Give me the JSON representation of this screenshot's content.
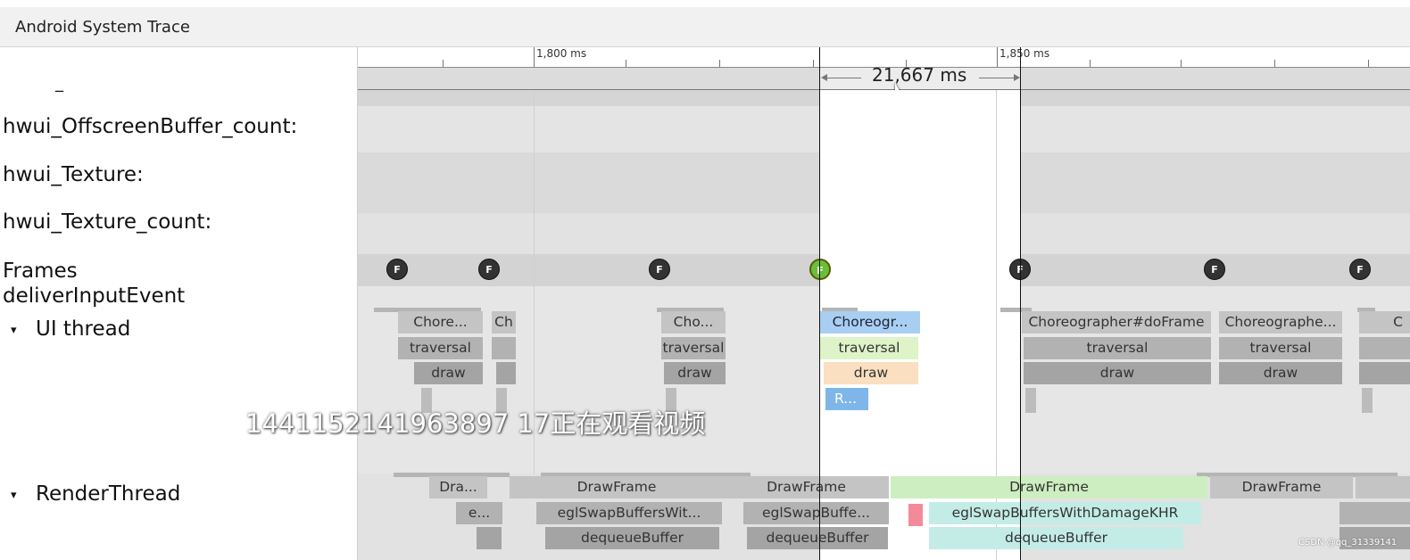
{
  "app": {
    "title": "Android System Trace"
  },
  "ruler": {
    "tick_1": "1,800 ms",
    "tick_2": "1,850 ms",
    "selection_label": "21,667 ms"
  },
  "tracks": {
    "dash": "_",
    "offscreen_buffer_count": "hwui_OffscreenBuffer_count:",
    "texture": "hwui_Texture:",
    "texture_count": "hwui_Texture_count:",
    "frames": "Frames",
    "deliver_input": "deliverInputEvent",
    "ui_thread": "UI thread",
    "render_thread": "RenderThread",
    "expand_glyph": "▾"
  },
  "frame_marker": "F",
  "ui": {
    "chore_1": "Chore...",
    "ch": "Ch",
    "traversal": "traversal",
    "draw": "draw",
    "cho": "Cho...",
    "choreog_sel": "Choreogr...",
    "r_sel": "R...",
    "choreo_full": "Choreographer#doFrame",
    "choreographe": "Choreographe...",
    "c_edge": "C"
  },
  "render": {
    "dra": "Dra...",
    "e": "e...",
    "drawframe": "DrawFrame",
    "egl_short": "eglSwapBuffersWit...",
    "egl_sel": "eglSwapBuffe...",
    "egl_full": "eglSwapBuffersWithDamageKHR",
    "dequeue": "dequeueBuffer"
  },
  "overlay": {
    "watermark": "1441152141963897 17正在观看视频",
    "csdn": "CSDN @qq_31339141"
  },
  "colors": {
    "selection_blue": "#a8cff2",
    "selection_green": "#def3c8",
    "selection_orange": "#fadfc0",
    "selection_small_blue": "#7fb6ea",
    "frame_green": "#6abf3a",
    "drawframe_green": "#cdeec0",
    "egl_cyan": "#c3ece6",
    "pink_mark": "#f28a9a"
  }
}
